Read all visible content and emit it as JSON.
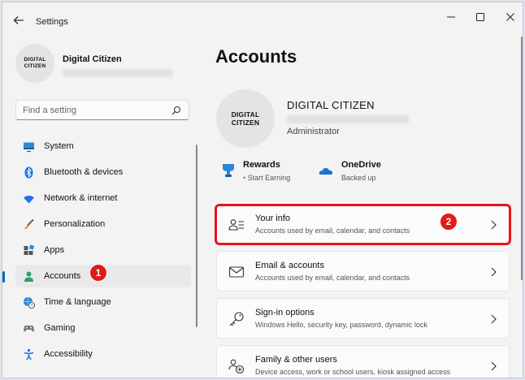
{
  "window": {
    "title": "Settings"
  },
  "profile": {
    "logo_line1": "DIGITAL",
    "logo_line2": "CITIZEN",
    "name": "Digital Citizen"
  },
  "search": {
    "placeholder": "Find a setting"
  },
  "nav": {
    "items": [
      {
        "label": "System",
        "icon": "display-icon"
      },
      {
        "label": "Bluetooth & devices",
        "icon": "bluetooth-icon"
      },
      {
        "label": "Network & internet",
        "icon": "wifi-icon"
      },
      {
        "label": "Personalization",
        "icon": "brush-icon"
      },
      {
        "label": "Apps",
        "icon": "apps-icon"
      },
      {
        "label": "Accounts",
        "icon": "person-icon",
        "active": true
      },
      {
        "label": "Time & language",
        "icon": "globe-clock-icon"
      },
      {
        "label": "Gaming",
        "icon": "gamepad-icon"
      },
      {
        "label": "Accessibility",
        "icon": "accessibility-icon"
      }
    ]
  },
  "markers": {
    "one": "1",
    "two": "2"
  },
  "main": {
    "title": "Accounts",
    "account": {
      "logo_line1": "DIGITAL",
      "logo_line2": "CITIZEN",
      "name": "DIGITAL CITIZEN",
      "role": "Administrator"
    },
    "services": [
      {
        "title": "Rewards",
        "subtitle": "Start Earning",
        "icon": "rewards-trophy-icon"
      },
      {
        "title": "OneDrive",
        "subtitle": "Backed up",
        "icon": "onedrive-cloud-icon"
      }
    ],
    "cards": [
      {
        "title": "Your info",
        "subtitle": "Accounts used by email, calendar, and contacts",
        "icon": "person-info-icon"
      },
      {
        "title": "Email & accounts",
        "subtitle": "Accounts used by email, calendar, and contacts",
        "icon": "mail-icon"
      },
      {
        "title": "Sign-in options",
        "subtitle": "Windows Hello, security key, password, dynamic lock",
        "icon": "key-icon"
      },
      {
        "title": "Family & other users",
        "subtitle": "Device access, work or school users, kiosk assigned access",
        "icon": "family-add-icon"
      }
    ]
  },
  "colors": {
    "accent": "#0067c0",
    "marker": "#e01b1b",
    "highlight": "#e8141b"
  }
}
